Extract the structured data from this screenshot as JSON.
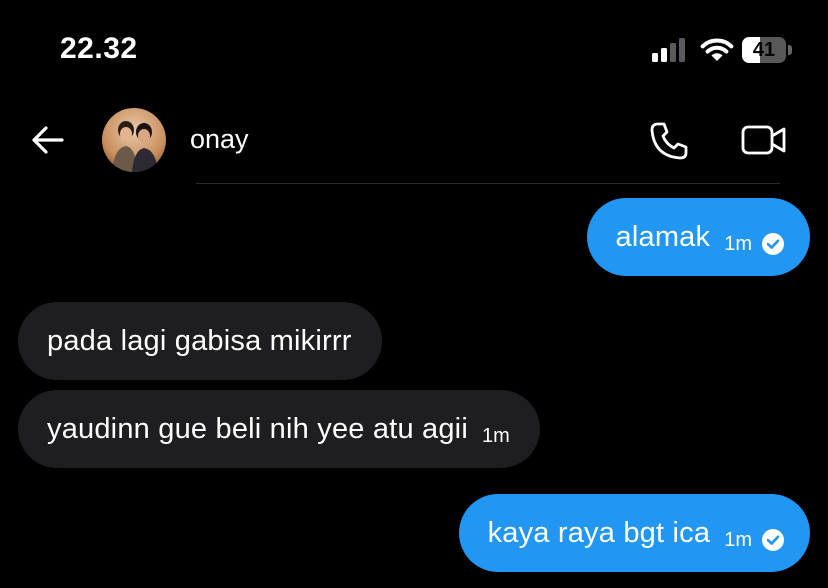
{
  "status_bar": {
    "time": "22.32",
    "battery_level": "41",
    "signal_icon": "cellular-signal-icon",
    "wifi_icon": "wifi-icon"
  },
  "header": {
    "contact_name": "onay",
    "back_icon": "arrow-left-icon",
    "call_icon": "phone-icon",
    "video_icon": "video-camera-icon"
  },
  "messages": [
    {
      "direction": "sent",
      "text": "alamak",
      "time": "1m",
      "status": "read"
    },
    {
      "direction": "received",
      "text": "pada lagi gabisa mikirrr",
      "time": "",
      "status": ""
    },
    {
      "direction": "received",
      "text": "yaudinn gue beli nih yee atu agii",
      "time": "1m",
      "status": ""
    },
    {
      "direction": "sent",
      "text": "kaya raya bgt ica",
      "time": "1m",
      "status": "read"
    }
  ],
  "colors": {
    "sent_bubble": "#2196f3",
    "received_bubble": "#1e1e20",
    "background": "#000000"
  }
}
